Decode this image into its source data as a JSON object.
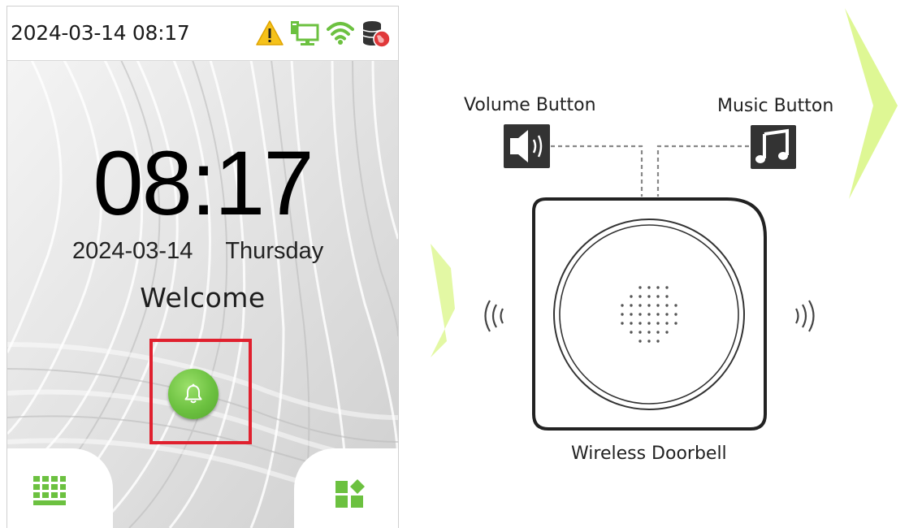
{
  "device": {
    "status_bar": {
      "datetime": "2024-03-14 08:17",
      "icons": [
        "warning-icon",
        "network-computer-icon",
        "wifi-icon",
        "database-globe-icon"
      ]
    },
    "clock": {
      "time": "08:17",
      "date": "2024-03-14",
      "weekday": "Thursday"
    },
    "welcome_text": "Welcome",
    "bell_button_icon": "bell-icon",
    "bottom_left_icon": "keypad-icon",
    "bottom_right_icon": "main-menu-icon",
    "colors": {
      "accent": "#6cc140",
      "highlight": "#e0202e"
    }
  },
  "diagram": {
    "volume_button_label": "Volume Button",
    "music_button_label": "Music Button",
    "doorbell_label": "Wireless Doorbell",
    "volume_icon": "speaker-icon",
    "music_icon": "music-note-icon"
  }
}
